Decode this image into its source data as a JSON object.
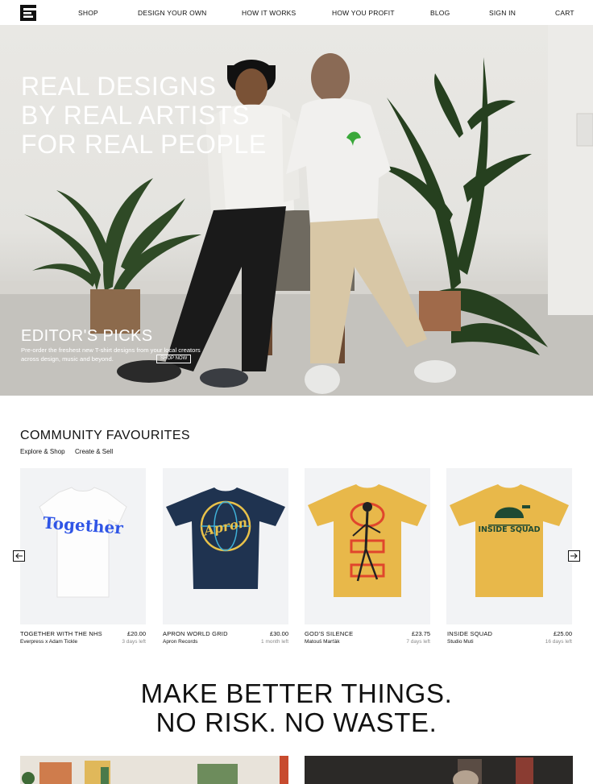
{
  "nav": {
    "items": [
      {
        "label": "SHOP"
      },
      {
        "label": "DESIGN YOUR OWN"
      },
      {
        "label": "HOW IT WORKS"
      },
      {
        "label": "HOW YOU PROFIT"
      },
      {
        "label": "BLOG"
      },
      {
        "label": "SIGN IN"
      },
      {
        "label": "CART"
      }
    ],
    "logo_icon": "everpress-logo-icon"
  },
  "hero": {
    "title_lines": [
      "REAL DESIGNS",
      "BY REAL ARTISTS",
      "FOR REAL PEOPLE"
    ],
    "picks_title": "EDITOR'S PICKS",
    "picks_description": "Pre-order the freshest new T-shirt designs from your local creators across design, music and beyond.",
    "shop_now_label": "SHOP NOW"
  },
  "community": {
    "title": "COMMUNITY FAVOURITES",
    "tabs": [
      {
        "label": "Explore & Shop"
      },
      {
        "label": "Create & Sell"
      }
    ],
    "prev_icon": "arrow-left-icon",
    "next_icon": "arrow-right-icon",
    "products": [
      {
        "name": "TOGETHER WITH THE NHS",
        "price": "£20.00",
        "creator": "Everpress x Adam Tickle",
        "time_left": "3 days left",
        "shirt_color": "#ffffff",
        "print_text": "Together"
      },
      {
        "name": "APRON WORLD GRID",
        "price": "£30.00",
        "creator": "Apron Records",
        "time_left": "1 month left",
        "shirt_color": "#1f3350",
        "print_text": "Apron"
      },
      {
        "name": "GOD'S SILENCE",
        "price": "£23.75",
        "creator": "Matouš Marťák",
        "time_left": "7 days left",
        "shirt_color": "#e8b84a",
        "print_text": ""
      },
      {
        "name": "INSIDE SQUAD",
        "price": "£25.00",
        "creator": "Studio Muti",
        "time_left": "16 days left",
        "shirt_color": "#e8b84a",
        "print_text": "INSIDE SQUAD"
      }
    ]
  },
  "tagline": {
    "lines": [
      "MAKE BETTER THINGS.",
      "NO RISK. NO WASTE."
    ]
  },
  "colors": {
    "text": "#111111",
    "card_background": "#f2f3f5",
    "muted": "#8a8a8a"
  }
}
